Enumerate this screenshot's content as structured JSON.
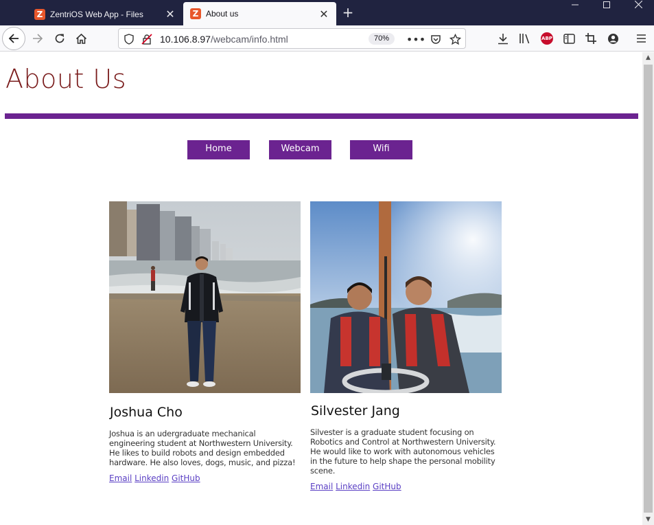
{
  "browser": {
    "tabs": [
      {
        "title": "ZentriOS Web App - Files",
        "favicon": "Z",
        "active": false
      },
      {
        "title": "About us",
        "favicon": "Z",
        "active": true
      }
    ],
    "url_host": "10.106.8.97",
    "url_path": "/webcam/info.html",
    "zoom": "70%",
    "toolbar_icons": [
      "download-icon",
      "library-icon",
      "adblock-icon",
      "sidebar-icon",
      "crop-icon",
      "account-icon",
      "menu-icon"
    ],
    "adblock_label": "ABP"
  },
  "page": {
    "title": "About Us",
    "accent_color": "#6b2390",
    "title_color": "#7a1c1c",
    "nav": [
      "Home",
      "Webcam",
      "Wifi"
    ],
    "people": [
      {
        "name": "Joshua Cho",
        "bio": "Joshua is an udergraduate mechanical engineering student at Northwestern University. He likes to build robots and design embedded hardware. He also loves, dogs, music, and pizza!",
        "links": [
          "Email",
          "Linkedin",
          "GitHub"
        ]
      },
      {
        "name": "Silvester Jang",
        "bio": "Silvester is a graduate student focusing on Robotics and Control at Northwestern University. He would like to work with autonomous vehicles in the future to help shape the personal mobility scene.",
        "links": [
          "Email",
          "Linkedin",
          "GitHub"
        ]
      }
    ]
  }
}
